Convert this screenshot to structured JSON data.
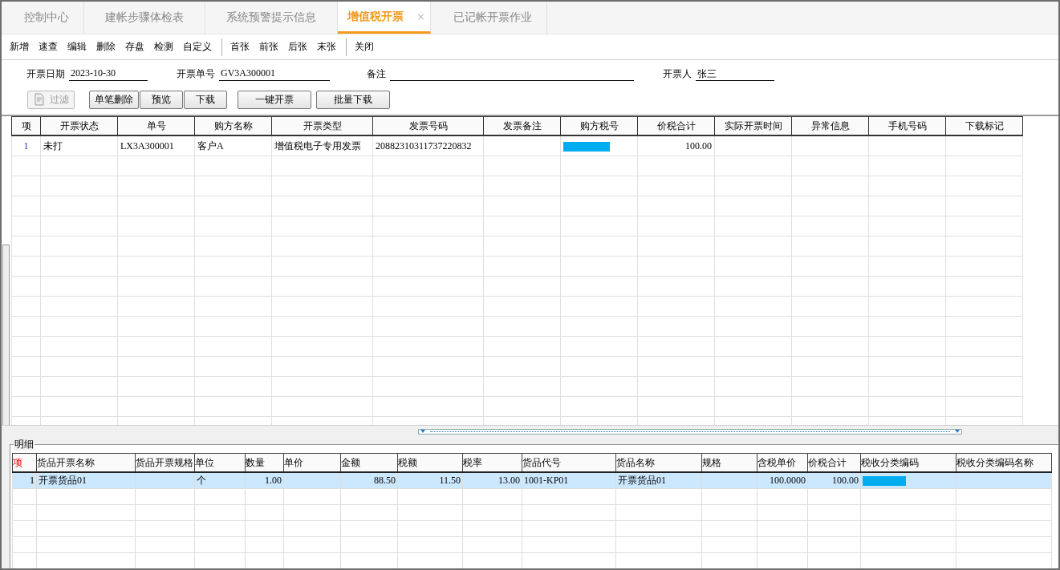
{
  "tabs": [
    {
      "label": "控制中心",
      "selected": false
    },
    {
      "label": "建帐步骤体检表",
      "selected": false
    },
    {
      "label": "系统预警提示信息",
      "selected": false
    },
    {
      "label": "增值税开票",
      "selected": true,
      "close": "×"
    },
    {
      "label": "已记帐开票作业",
      "selected": false
    }
  ],
  "toolbar": [
    [
      "新增",
      "速查",
      "编辑",
      "删除",
      "存盘",
      "检测",
      "自定义"
    ],
    [
      "首张",
      "前张",
      "后张",
      "末张"
    ],
    [
      "关闭"
    ]
  ],
  "form_fields": [
    {
      "label": "开票日期",
      "value": "2023-10-30",
      "kind": "short"
    },
    {
      "label": "开票单号",
      "value": "GV3A300001",
      "kind": "medium"
    },
    {
      "label": "备注",
      "kind": "long"
    },
    {
      "label": "开票人",
      "value": "张三",
      "kind": "short"
    }
  ],
  "action_buttons": [
    [
      {
        "label": "过滤",
        "disabled": true,
        "kind": "icon"
      }
    ],
    [
      {
        "label": "单笔删除",
        "disabled": false,
        "kind": "plain"
      },
      {
        "label": "预览",
        "disabled": false,
        "kind": "plain"
      },
      {
        "label": "下载",
        "disabled": false,
        "kind": "plain"
      }
    ],
    [
      {
        "label": "一键开票",
        "disabled": false,
        "kind": "plain"
      },
      {
        "label": "批量下载",
        "disabled": false,
        "kind": "plain"
      }
    ]
  ],
  "invoice_table": {
    "columns": [
      "项",
      "开票状态",
      "单号",
      "购方名称",
      "开票类型",
      "发票号码",
      "发票备注",
      "购方税号",
      "价税合计",
      "实际开票时间",
      "异常信息",
      "手机号码",
      "下载标记"
    ],
    "rows": [
      {
        "cells": [
          "1",
          "未打",
          "LX3A300001",
          "客户A",
          "增值税电子专用发票",
          "20882310311737220832",
          "",
          {
            "masked": true
          },
          "100.00",
          "",
          "",
          "",
          ""
        ]
      }
    ]
  },
  "detail": {
    "title": "明细",
    "columns": [
      "项",
      "货品开票名称",
      "货品开票规格",
      "单位",
      "数量",
      "单价",
      "金额",
      "税额",
      "税率",
      "货品代号",
      "货品名称",
      "规格",
      "含税单价",
      "价税合计",
      "税收分类编码",
      "税收分类编码名称"
    ],
    "rows": [
      {
        "selected": true,
        "cells": [
          "1",
          "开票货品01",
          "",
          "个",
          "1.00",
          "",
          "88.50",
          "11.50",
          "13.00",
          "1001-KP01",
          "开票货品01",
          "",
          "100.0000",
          "100.00",
          {
            "masked": true
          },
          ""
        ]
      }
    ]
  }
}
